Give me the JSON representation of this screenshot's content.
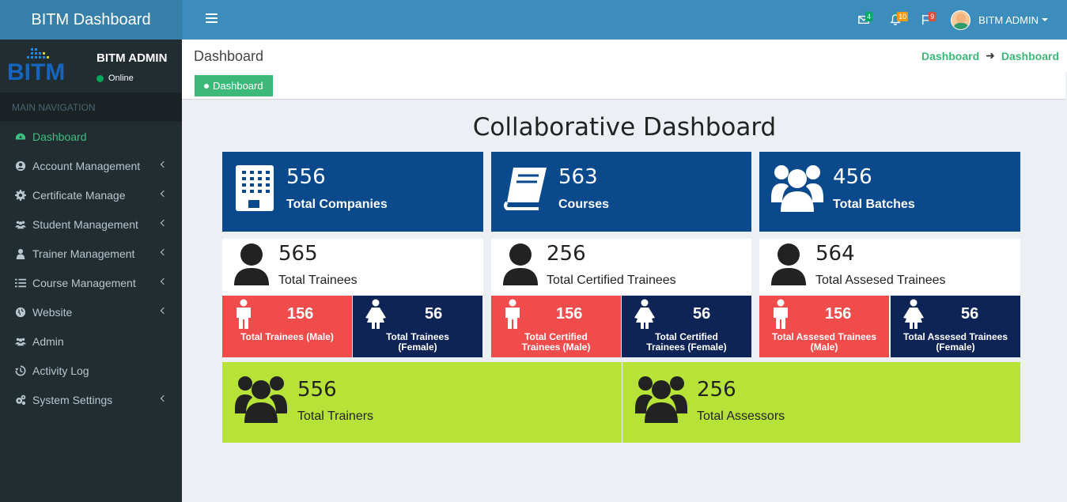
{
  "app": {
    "title": "BITM Dashboard"
  },
  "topbar": {
    "messages_count": "4",
    "notifications_count": "10",
    "flags_count": "9",
    "user_name": "BITM ADMIN",
    "colors": {
      "messages": "#00a65a",
      "notifications": "#f39c12",
      "flags": "#dd4b39"
    }
  },
  "sidebar": {
    "logo_text": "BITM",
    "user_name": "BITM ADMIN",
    "status": "Online",
    "header": "MAIN NAVIGATION",
    "items": [
      {
        "label": "Dashboard",
        "icon": "dashboard-icon",
        "active": true
      },
      {
        "label": "Account Management",
        "icon": "user-circle-icon"
      },
      {
        "label": "Certificate Manage",
        "icon": "gear-icon"
      },
      {
        "label": "Student Management",
        "icon": "users-icon"
      },
      {
        "label": "Trainer Management",
        "icon": "user-icon"
      },
      {
        "label": "Course Management",
        "icon": "list-icon"
      },
      {
        "label": "Website",
        "icon": "globe-icon"
      },
      {
        "label": "Admin",
        "icon": "users-icon"
      },
      {
        "label": "Activity Log",
        "icon": "history-icon"
      },
      {
        "label": "System Settings",
        "icon": "cogs-icon"
      }
    ]
  },
  "header": {
    "page_title": "Dashboard",
    "breadcrumb": [
      "Dashboard",
      "Dashboard"
    ],
    "tab_label": "Dashboard"
  },
  "dashboard": {
    "title": "Collaborative Dashboard",
    "top_cards": [
      {
        "value": "556",
        "label": "Total Companies",
        "icon": "building-icon"
      },
      {
        "value": "563",
        "label": "Courses",
        "icon": "book-icon"
      },
      {
        "value": "456",
        "label": "Total Batches",
        "icon": "users-icon"
      }
    ],
    "trainee_cards": [
      {
        "value": "565",
        "label": "Total Trainees",
        "male": {
          "value": "156",
          "label": "Total Trainees (Male)"
        },
        "female": {
          "value": "56",
          "label": "Total Trainees (Female)"
        }
      },
      {
        "value": "256",
        "label": "Total Certified Trainees",
        "male": {
          "value": "156",
          "label": "Total Certified Trainees (Male)"
        },
        "female": {
          "value": "56",
          "label": "Total Certified Trainees (Female)"
        }
      },
      {
        "value": "564",
        "label": "Total Assesed Trainees",
        "male": {
          "value": "156",
          "label": "Total Assesed Trainees (Male)"
        },
        "female": {
          "value": "56",
          "label": "Total Assesed Trainees (Female)"
        }
      }
    ],
    "bottom_cards": [
      {
        "value": "556",
        "label": "Total Trainers",
        "icon": "users-icon"
      },
      {
        "value": "256",
        "label": "Total Assessors",
        "icon": "users-icon"
      }
    ]
  }
}
